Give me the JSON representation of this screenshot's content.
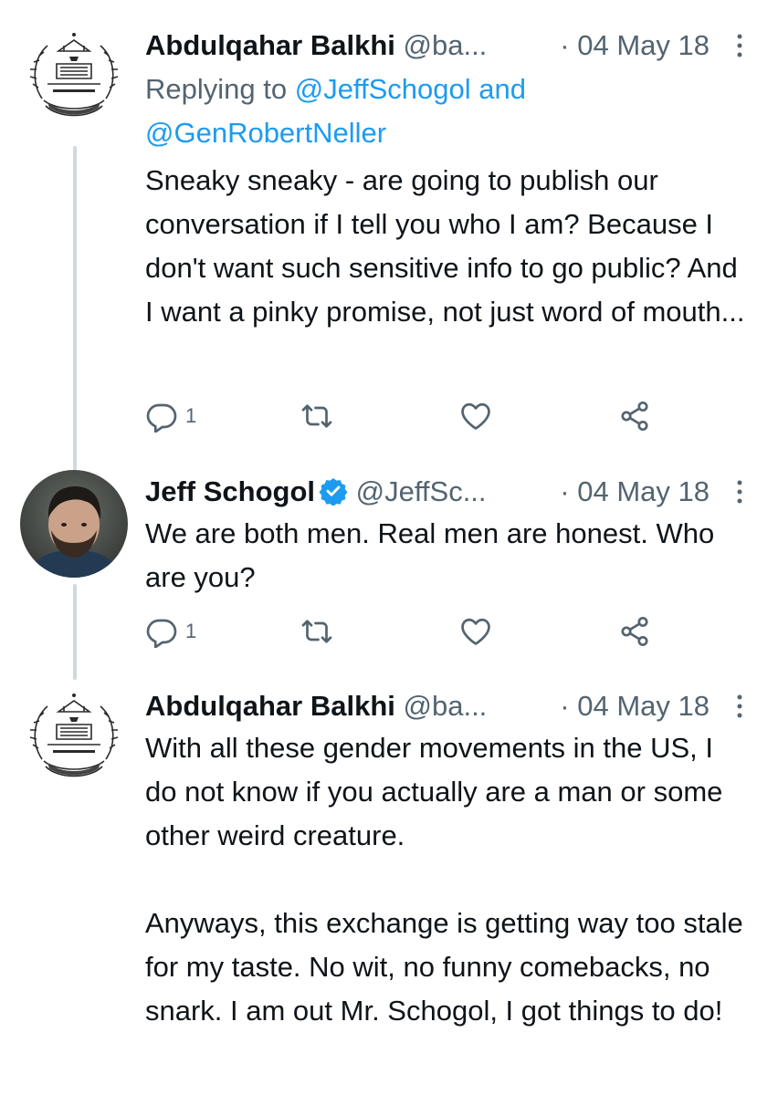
{
  "tweets": [
    {
      "name": "Abdulqahar Balkhi",
      "handle": "@ba...",
      "date": "04 May 18",
      "reply_prefix": "Replying to ",
      "reply_user1": "@JeffSchogol",
      "reply_and": " and",
      "reply_user2": "@GenRobertNeller",
      "text": "Sneaky sneaky - are going to publish our conversation if I tell you who I am? Because I don't want such sensitive info to go public? And I want a pinky promise, not just word of mouth...",
      "reply_count": "1",
      "avatar": "emblem-avatar"
    },
    {
      "name": "Jeff Schogol",
      "handle": "@JeffSc...",
      "date": "04 May 18",
      "verified": true,
      "text": "We are both men. Real men are honest. Who are you?",
      "reply_count": "1",
      "avatar": "photo-avatar"
    },
    {
      "name": "Abdulqahar Balkhi",
      "handle": "@ba...",
      "date": "04 May 18",
      "text": "With all these gender movements in the US, I do not know if you actually are a man or some other weird creature.\n\nAnyways, this exchange is getting way too stale for my taste. No wit, no funny comebacks, no snark. I am out Mr. Schogol, I got things to do!",
      "avatar": "emblem-avatar"
    }
  ],
  "colors": {
    "text": "#0f1419",
    "secondary": "#536471",
    "link": "#1d9bf0",
    "thread_line": "#cfd9de",
    "verified": "#1d9bf0"
  },
  "icons": [
    "reply-icon",
    "retweet-icon",
    "like-icon",
    "share-icon",
    "more-icon",
    "verified-badge-icon"
  ]
}
